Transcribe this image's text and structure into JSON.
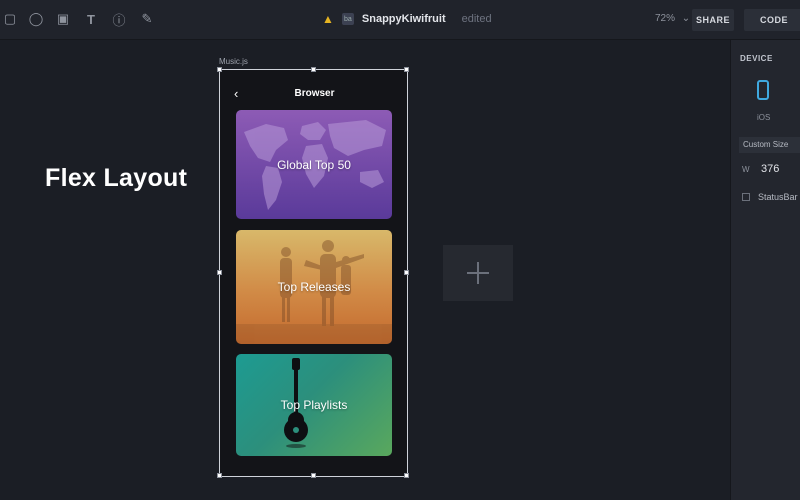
{
  "toolbar": {
    "tools": [
      {
        "name": "rectangle-tool-icon",
        "glyph": "▢"
      },
      {
        "name": "circle-tool-icon",
        "glyph": "◯"
      },
      {
        "name": "image-tool-icon",
        "glyph": "▣"
      },
      {
        "name": "text-tool-icon",
        "glyph": "T"
      },
      {
        "name": "info-tool-icon",
        "glyph": "ⓘ"
      },
      {
        "name": "pen-tool-icon",
        "glyph": "✎"
      }
    ],
    "warning_icon": "warning-icon",
    "app_badge": "ba",
    "document_name": "SnappyKiwifruit",
    "document_status": "edited",
    "zoom_value": "72%",
    "share_label": "SHARE",
    "code_label": "CODE"
  },
  "canvas": {
    "heading": "Flex Layout",
    "frame_label": "Music.js",
    "phone": {
      "back_glyph": "‹",
      "title": "Browser",
      "cards": [
        {
          "label": "Global Top 50",
          "color_top": "#8d5bb5",
          "color_bottom": "#5a3a9a"
        },
        {
          "label": "Top Releases",
          "color_top": "#d8b86a",
          "color_bottom": "#c46a2e"
        },
        {
          "label": "Top Playlists",
          "color_top": "#1d9b92",
          "color_bottom": "#5aa85d"
        }
      ]
    }
  },
  "panel": {
    "title": "DEVICE",
    "device_label": "iOS",
    "size_option": "Custom Size",
    "width_label": "W",
    "width_value": "376",
    "statusbar_label": "StatusBar"
  },
  "colors": {
    "accent": "#3fa9e0",
    "background": "#1b1e25",
    "toolbar": "#20232b",
    "warning": "#e6b422"
  }
}
